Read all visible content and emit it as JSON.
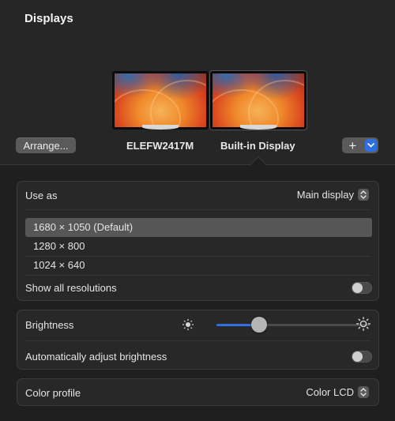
{
  "window": {
    "title": "Displays"
  },
  "displays": [
    {
      "name": "ELEFW2417M",
      "selected": false
    },
    {
      "name": "Built-in Display",
      "selected": true
    }
  ],
  "toolbar": {
    "arrange_label": "Arrange...",
    "add_label": "+",
    "add_menu_icon": "chevron-down-icon"
  },
  "use_as": {
    "label": "Use as",
    "value": "Main display"
  },
  "resolutions": {
    "items": [
      "1680 × 1050 (Default)",
      "1280 × 800",
      "1024 × 640"
    ],
    "selected_index": 0,
    "show_all_label": "Show all resolutions",
    "show_all_enabled": false
  },
  "brightness": {
    "label": "Brightness",
    "level": 0.28,
    "auto_label": "Automatically adjust brightness",
    "auto_enabled": false
  },
  "color_profile": {
    "label": "Color profile",
    "value": "Color LCD"
  },
  "colors": {
    "accent": "#2f6fe0",
    "background": "#1f1f1f",
    "panel": "#282828"
  }
}
